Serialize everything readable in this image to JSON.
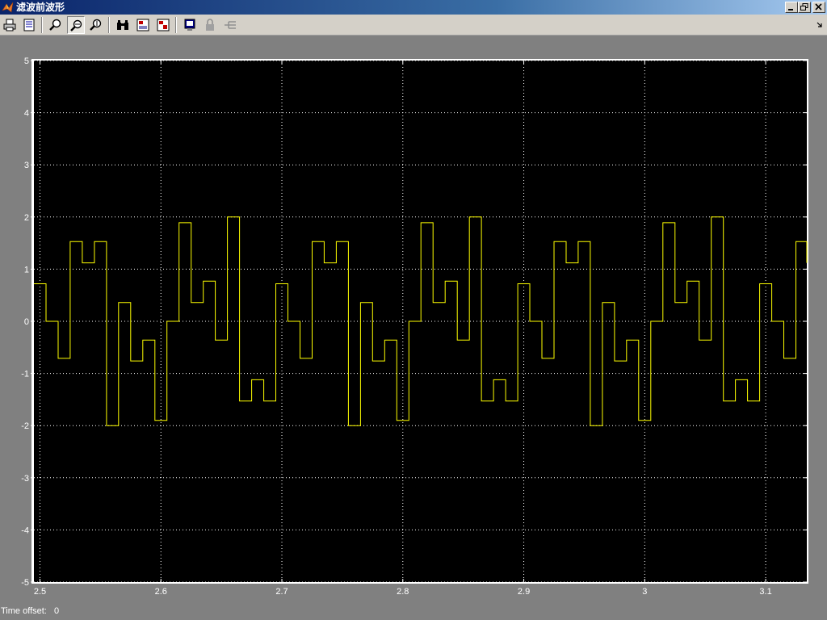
{
  "window": {
    "title": "滤波前波形",
    "controls": [
      "minimize",
      "restore",
      "close"
    ]
  },
  "toolbar": {
    "buttons": [
      {
        "name": "print-icon"
      },
      {
        "name": "parameters-icon"
      },
      {
        "name": "zoom-icon"
      },
      {
        "name": "zoom-x-icon",
        "pressed": true
      },
      {
        "name": "zoom-y-icon"
      },
      {
        "name": "autoscale-icon"
      },
      {
        "name": "save-axes-icon"
      },
      {
        "name": "restore-axes-icon"
      },
      {
        "name": "floating-scope-icon"
      },
      {
        "name": "lock-icon"
      },
      {
        "name": "signal-selector-icon"
      }
    ]
  },
  "status": {
    "time_offset_label": "Time offset:",
    "time_offset_value": "0"
  },
  "colors": {
    "background": "#808080",
    "axes": "#000000",
    "trace": "#ffff00",
    "grid": "#ffffff"
  },
  "chart_data": {
    "type": "line",
    "step": true,
    "grid": true,
    "xlim": [
      2.495,
      3.134
    ],
    "ylim": [
      -5,
      5
    ],
    "x_ticks": [
      "2.5",
      "2.6",
      "2.7",
      "2.8",
      "2.9",
      "3",
      "3.1"
    ],
    "y_ticks": [
      "5",
      "4",
      "3",
      "2",
      "1",
      "0",
      "-1",
      "-2",
      "-3",
      "-4",
      "-5"
    ],
    "series": [
      {
        "x": [
          2.495,
          2.505,
          2.515,
          2.525,
          2.535,
          2.545,
          2.555,
          2.565,
          2.575,
          2.585,
          2.595,
          2.605,
          2.615,
          2.625,
          2.635,
          2.645,
          2.655,
          2.665,
          2.675,
          2.685,
          2.695,
          2.705,
          2.715,
          2.725,
          2.735,
          2.745,
          2.755,
          2.765,
          2.775,
          2.785,
          2.795,
          2.805,
          2.815,
          2.825,
          2.835,
          2.845,
          2.855,
          2.865,
          2.875,
          2.885,
          2.895,
          2.905,
          2.915,
          2.925,
          2.935,
          2.945,
          2.955,
          2.965,
          2.975,
          2.985,
          2.995,
          3.005,
          3.015,
          3.025,
          3.035,
          3.045,
          3.055,
          3.065,
          3.075,
          3.085,
          3.095,
          3.105,
          3.115,
          3.125,
          3.134
        ],
        "y": [
          0.72,
          0,
          -0.71,
          1.53,
          1.12,
          1.53,
          -2,
          0.36,
          -0.76,
          -0.36,
          -1.9,
          0,
          1.89,
          0.36,
          0.77,
          -0.36,
          2,
          -1.53,
          -1.12,
          -1.53,
          0.72,
          0,
          -0.71,
          1.53,
          1.12,
          1.53,
          -2,
          0.36,
          -0.76,
          -0.36,
          -1.9,
          0,
          1.89,
          0.36,
          0.77,
          -0.36,
          2,
          -1.53,
          -1.12,
          -1.53,
          0.72,
          0,
          -0.71,
          1.53,
          1.12,
          1.53,
          -2,
          0.36,
          -0.76,
          -0.36,
          -1.9,
          0,
          1.89,
          0.36,
          0.77,
          -0.36,
          2,
          -1.53,
          -1.12,
          -1.53,
          0.72,
          0,
          -0.71,
          1.53,
          1.12
        ]
      }
    ]
  }
}
